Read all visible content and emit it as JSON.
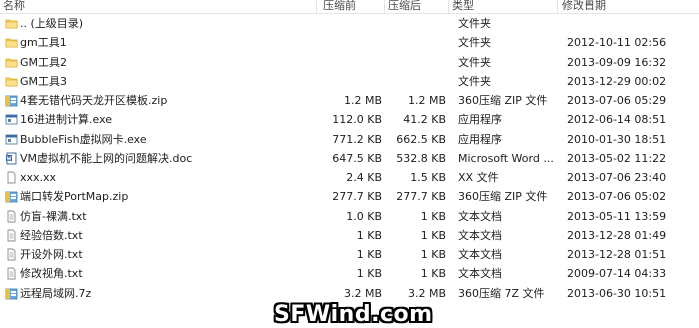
{
  "columns": {
    "name": "名称",
    "compressed_size": "压缩前",
    "size": "压缩后",
    "type": "类型",
    "modified": "修改日期"
  },
  "files": [
    {
      "name": ".. (上级目录)",
      "csize": "",
      "size": "",
      "type": "文件夹",
      "date": "",
      "icon": "folder-up-icon"
    },
    {
      "name": "gm工具1",
      "csize": "",
      "size": "",
      "type": "文件夹",
      "date": "2012-10-11 02:56",
      "icon": "folder-icon"
    },
    {
      "name": "GM工具2",
      "csize": "",
      "size": "",
      "type": "文件夹",
      "date": "2013-09-09 16:32",
      "icon": "folder-icon"
    },
    {
      "name": "GM工具3",
      "csize": "",
      "size": "",
      "type": "文件夹",
      "date": "2013-12-29 00:02",
      "icon": "folder-icon"
    },
    {
      "name": "4套无错代码天龙开区模板.zip",
      "csize": "1.2 MB",
      "size": "1.2 MB",
      "type": "360压缩 ZIP 文件",
      "date": "2013-07-06 05:29",
      "icon": "zip-archive-icon"
    },
    {
      "name": "16进进制计算.exe",
      "csize": "112.0 KB",
      "size": "41.2 KB",
      "type": "应用程序",
      "date": "2012-06-14 08:51",
      "icon": "exe-icon"
    },
    {
      "name": "BubbleFish虚拟网卡.exe",
      "csize": "771.2 KB",
      "size": "662.5 KB",
      "type": "应用程序",
      "date": "2010-01-30 18:51",
      "icon": "exe-icon"
    },
    {
      "name": "VM虚拟机不能上网的问题解决.doc",
      "csize": "647.5 KB",
      "size": "532.8 KB",
      "type": "Microsoft Word ...",
      "date": "2013-05-02 11:22",
      "icon": "word-doc-icon"
    },
    {
      "name": "xxx.xx",
      "csize": "2.4 KB",
      "size": "1.5 KB",
      "type": "XX 文件",
      "date": "2013-07-06 23:40",
      "icon": "file-icon"
    },
    {
      "name": "端口转发PortMap.zip",
      "csize": "277.7 KB",
      "size": "277.7 KB",
      "type": "360压缩 ZIP 文件",
      "date": "2013-07-06 05:02",
      "icon": "zip-archive-icon"
    },
    {
      "name": "仿盲-裸满.txt",
      "csize": "1.0 KB",
      "size": "1 KB",
      "type": "文本文档",
      "date": "2013-05-11 13:59",
      "icon": "text-file-icon"
    },
    {
      "name": "经验倍数.txt",
      "csize": "1 KB",
      "size": "1 KB",
      "type": "文本文档",
      "date": "2013-12-28 01:49",
      "icon": "text-file-icon"
    },
    {
      "name": "开设外网.txt",
      "csize": "1 KB",
      "size": "1 KB",
      "type": "文本文档",
      "date": "2013-12-28 01:51",
      "icon": "text-file-icon"
    },
    {
      "name": "修改视角.txt",
      "csize": "1 KB",
      "size": "1 KB",
      "type": "文本文档",
      "date": "2009-07-14 04:33",
      "icon": "text-file-icon"
    },
    {
      "name": "远程局域网.7z",
      "csize": "3.2 MB",
      "size": "3.2 MB",
      "type": "360压缩 7Z 文件",
      "date": "2013-06-30 10:51",
      "icon": "7z-archive-icon"
    }
  ],
  "watermark": "SFWind.com"
}
